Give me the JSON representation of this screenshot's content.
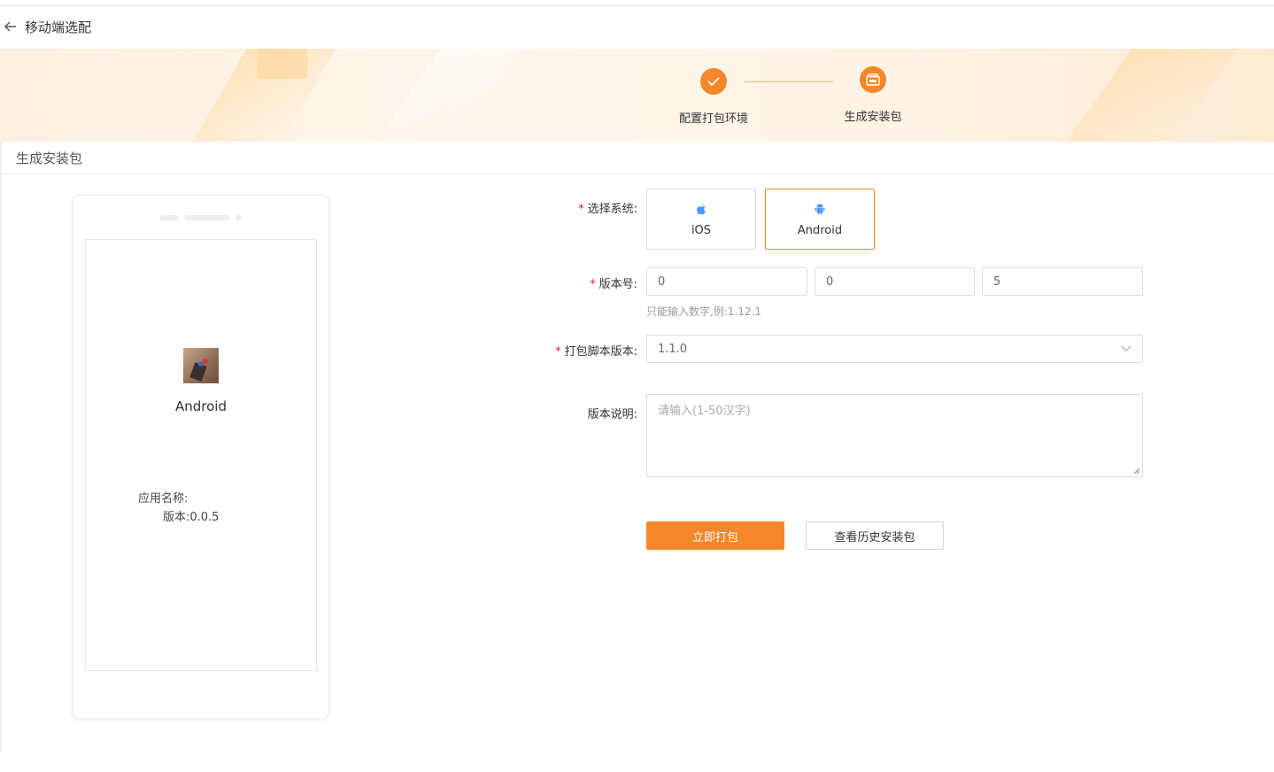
{
  "header": {
    "title": "移动端选配",
    "back_icon": "arrow-left-icon"
  },
  "steps": [
    {
      "label": "配置打包环境",
      "status": "done",
      "icon": "check-icon"
    },
    {
      "label": "生成安装包",
      "status": "active",
      "icon": "app-package-icon"
    }
  ],
  "section": {
    "title": "生成安装包"
  },
  "preview": {
    "platform": "Android",
    "app_name_label": "应用名称:",
    "version_text": "版本:0.0.5"
  },
  "form": {
    "system": {
      "label": "选择系统:",
      "required": "*",
      "options": [
        {
          "label": "iOS",
          "icon": "apple-icon",
          "selected": false
        },
        {
          "label": "Android",
          "icon": "android-icon",
          "selected": true
        }
      ]
    },
    "version": {
      "label": "版本号:",
      "required": "*",
      "values": [
        "0",
        "0",
        "5"
      ],
      "hint": "只能输入数字,例:1.12.1"
    },
    "script_version": {
      "label": "打包脚本版本:",
      "required": "*",
      "value": "1.1.0"
    },
    "description": {
      "label": "版本说明:",
      "placeholder": "请输入(1-50汉字)"
    }
  },
  "actions": {
    "primary": "立即打包",
    "secondary": "查看历史安装包"
  },
  "colors": {
    "accent": "#f5862a",
    "ios_icon": "#4a9bf5",
    "android_icon": "#4a9bf5"
  }
}
